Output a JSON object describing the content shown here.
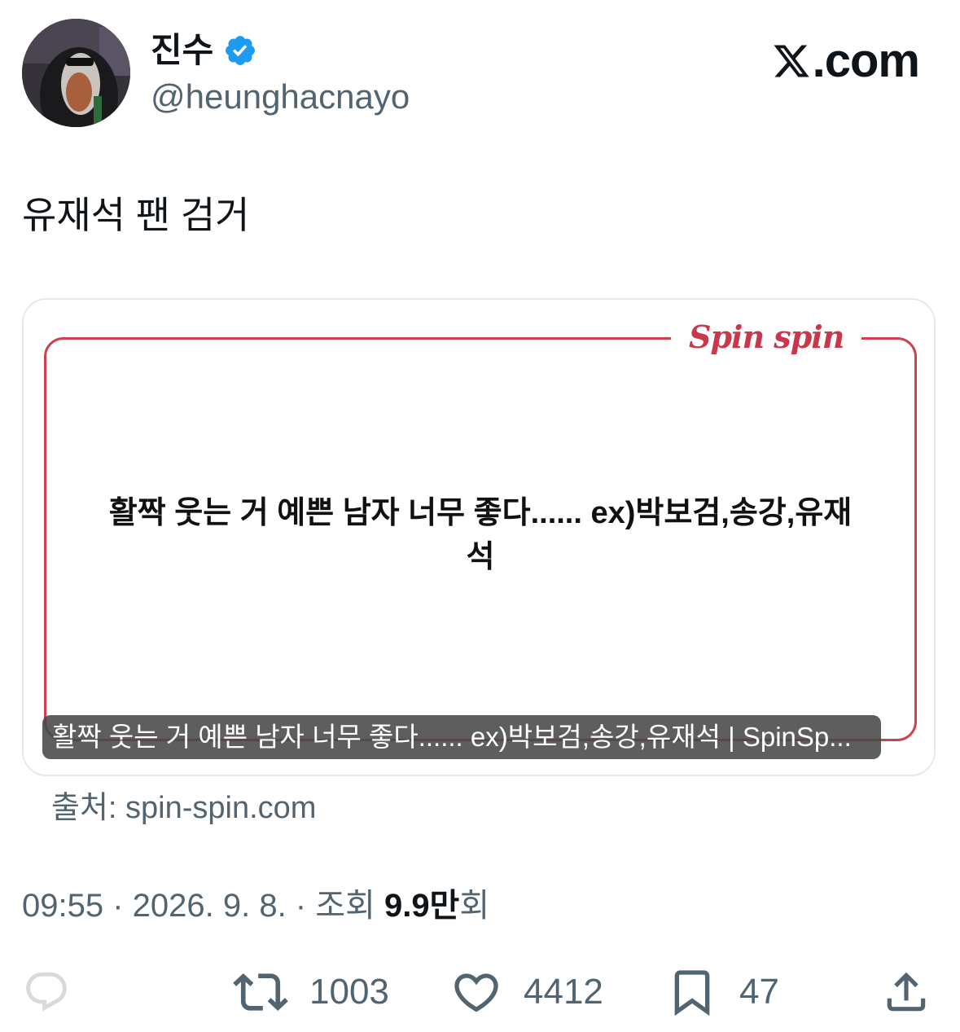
{
  "header": {
    "display_name": "진수",
    "handle": "@heunghacnayo",
    "site_label": ".com",
    "verified_icon": "verified-badge-icon"
  },
  "tweet": {
    "text": "유재석 팬 검거"
  },
  "card": {
    "logo": "Spin spin",
    "body_line1": "활짝 웃는 거 예쁜 남자 너무 좋다...... ex)박보검,송강,유재",
    "body_line2": "석",
    "caption": "활짝 웃는 거 예쁜 남자 너무 좋다...... ex)박보검,송강,유재석 | SpinSp...",
    "frame_color": "#d0404f"
  },
  "source": "출처: spin-spin.com",
  "meta": {
    "time_date": "09:55 · 2026. 9. 8. · 조회 ",
    "views": "9.9만",
    "views_suffix": "회"
  },
  "actions": {
    "reply_icon": "reply-icon",
    "retweet_count": "1003",
    "like_count": "4412",
    "bookmark_count": "47",
    "share_icon": "share-icon"
  },
  "colors": {
    "accent": "#1d9bf0",
    "muted": "#536471",
    "text": "#0f1419"
  }
}
